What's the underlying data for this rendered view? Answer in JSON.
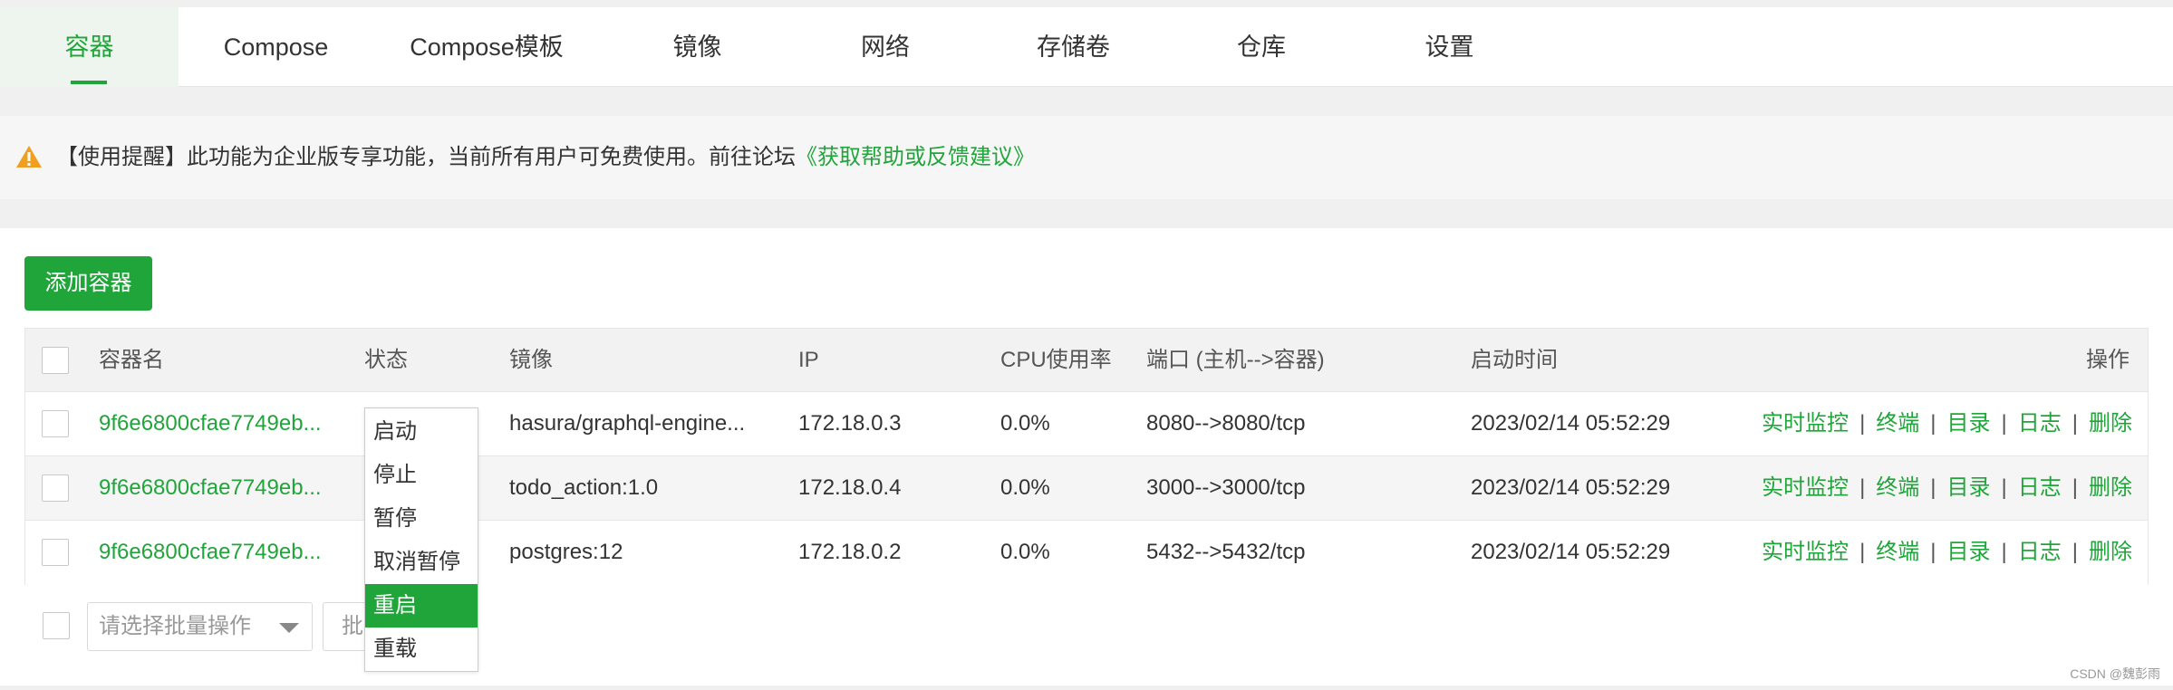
{
  "tabs": [
    "容器",
    "Compose",
    "Compose模板",
    "镜像",
    "网络",
    "存储卷",
    "仓库",
    "设置"
  ],
  "notice": {
    "text": "【使用提醒】此功能为企业版专享功能，当前所有用户可免费使用。前往论坛",
    "link": "《获取帮助或反馈建议》"
  },
  "add_button": "添加容器",
  "table": {
    "headers": {
      "name": "容器名",
      "status": "状态",
      "image": "镜像",
      "ip": "IP",
      "cpu": "CPU使用率",
      "port": "端口 (主机-->容器)",
      "time": "启动时间",
      "ops": "操作"
    },
    "rows": [
      {
        "name": "9f6e6800cfae7749eb...",
        "image": "hasura/graphql-engine...",
        "ip": "172.18.0.3",
        "cpu": "0.0%",
        "port": "8080-->8080/tcp",
        "time": "2023/02/14 05:52:29"
      },
      {
        "name": "9f6e6800cfae7749eb...",
        "image": "todo_action:1.0",
        "ip": "172.18.0.4",
        "cpu": "0.0%",
        "port": "3000-->3000/tcp",
        "time": "2023/02/14 05:52:29"
      },
      {
        "name": "9f6e6800cfae7749eb...",
        "image": "postgres:12",
        "ip": "172.18.0.2",
        "cpu": "0.0%",
        "port": "5432-->5432/tcp",
        "time": "2023/02/14 05:52:29"
      }
    ],
    "ops": [
      "实时监控",
      "终端",
      "目录",
      "日志",
      "删除"
    ],
    "op_separator": "|"
  },
  "batch": {
    "placeholder": "请选择批量操作",
    "button_partial": "批"
  },
  "dropdown": {
    "items": [
      "启动",
      "停止",
      "暂停",
      "取消暂停",
      "重启",
      "重载"
    ],
    "selected": "重启"
  },
  "watermark": "CSDN @魏彭雨",
  "colors": {
    "accent": "#20a53a",
    "warning": "#f0a020"
  }
}
